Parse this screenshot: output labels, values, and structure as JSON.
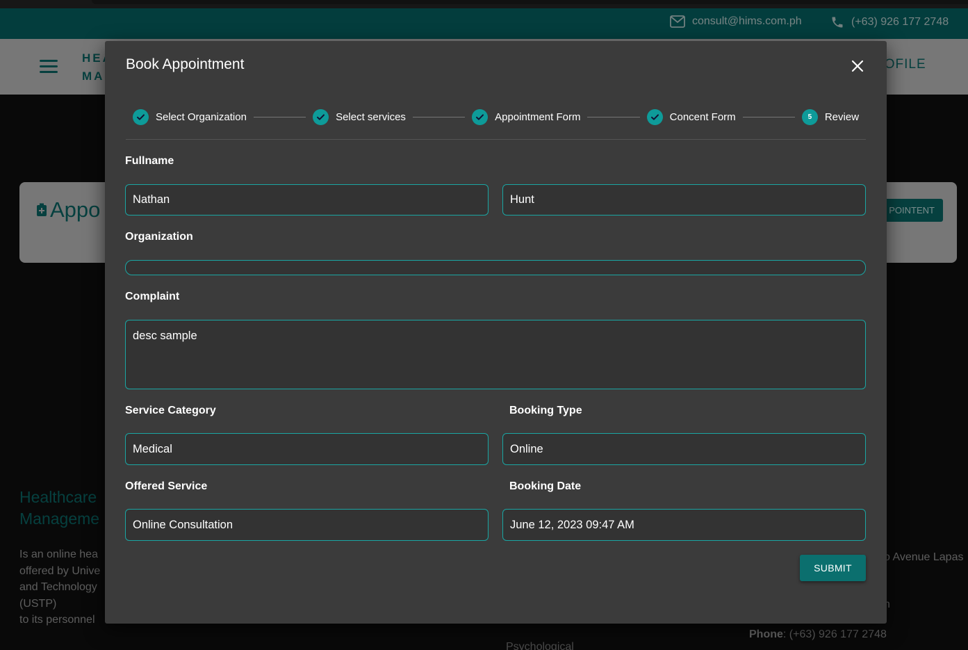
{
  "header": {
    "email": "consult@hims.com.ph",
    "phone": "(+63) 926 177 2748"
  },
  "nav": {
    "brand_line1": "HEA",
    "brand_line2": "MA",
    "profile_label": "ROFILE"
  },
  "background_page": {
    "card_title": "Appo",
    "book_button": "POINTENT",
    "footer_title_line1": "Healthcare",
    "footer_title_line2": "Manageme",
    "footer_desc": [
      "Is an online hea",
      "offered by Unive",
      "and Technology",
      "(USTP)",
      "to its personnel"
    ],
    "footer_address": "o Avenue Lapas",
    "footer_n": "n",
    "footer_phone_label": "Phone",
    "footer_phone_value": ": (+63) 926 177 2748",
    "footer_psych": "Psychological"
  },
  "modal": {
    "title": "Book Appointment",
    "steps": [
      {
        "label": "Select Organization",
        "done": true
      },
      {
        "label": "Select services",
        "done": true
      },
      {
        "label": "Appointment Form",
        "done": true
      },
      {
        "label": "Concent Form",
        "done": true
      },
      {
        "label": "Review",
        "number": "5",
        "done": false
      }
    ],
    "form": {
      "fullname_label": "Fullname",
      "first_name": "Nathan",
      "last_name": "Hunt",
      "organization_label": "Organization",
      "organization_value": "",
      "complaint_label": "Complaint",
      "complaint_value": "desc sample",
      "service_category_label": "Service Category",
      "service_category_value": "Medical",
      "booking_type_label": "Booking Type",
      "booking_type_value": "Online",
      "offered_service_label": "Offered Service",
      "offered_service_value": "Online Consultation",
      "booking_date_label": "Booking Date",
      "booking_date_value": "June 12, 2023 09:47 AM"
    },
    "submit_label": "SUBMIT"
  },
  "colors": {
    "accent": "#0e9b99",
    "topbar": "#06706f",
    "modal_bg": "#3b3b3b",
    "field_border": "#1aa6a3"
  }
}
